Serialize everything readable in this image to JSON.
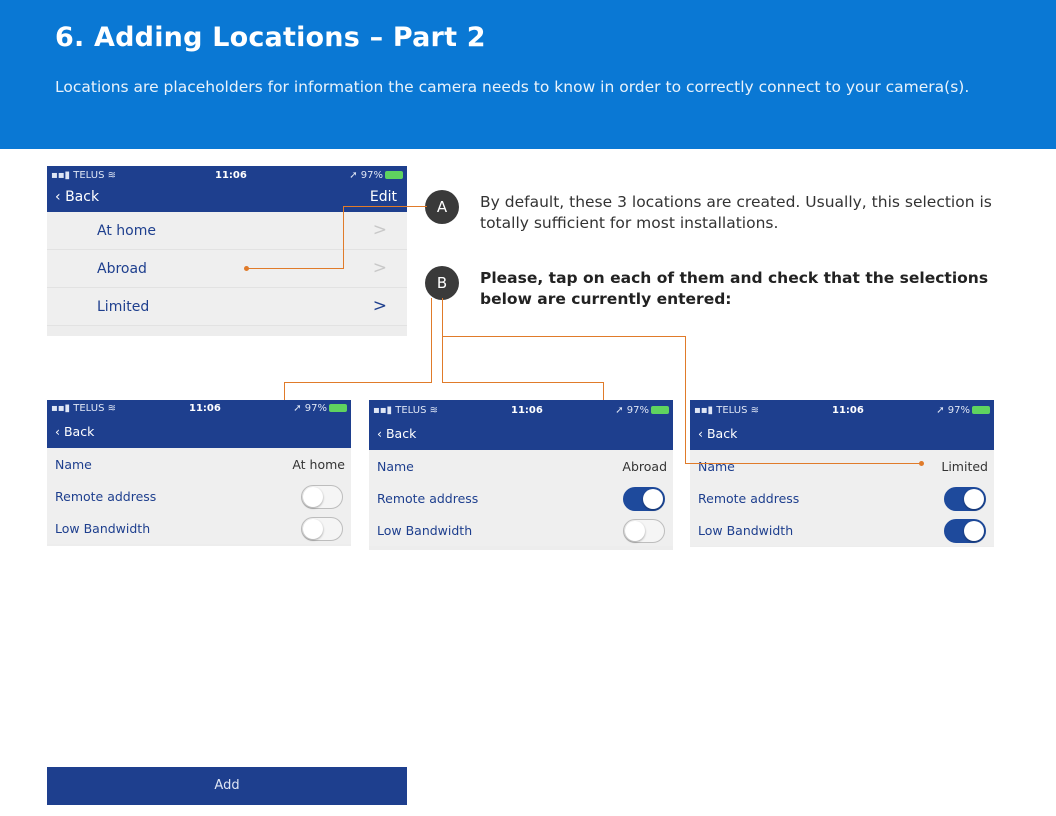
{
  "header": {
    "title": "6. Adding Locations – Part 2",
    "subtitle": "Locations are placeholders for information the camera needs to know in order to correctly connect to your camera(s)."
  },
  "status": {
    "carrier": "TELUS",
    "time": "11:06",
    "battery": "97%"
  },
  "nav": {
    "back": "Back",
    "edit": "Edit"
  },
  "locations": [
    {
      "label": "At home",
      "chevron": ">"
    },
    {
      "label": "Abroad",
      "chevron": ">"
    },
    {
      "label": "Limited",
      "chevron": ">"
    }
  ],
  "notes": {
    "a_badge": "A",
    "a_text": "By default, these 3 locations are created. Usually, this selection is totally sufficient for most installations.",
    "b_badge": "B",
    "b_text": "Please, tap on each of them and check that the selections below are currently entered:"
  },
  "details": {
    "name_label": "Name",
    "remote_label": "Remote address",
    "bandwidth_label": "Low Bandwidth",
    "screens": [
      {
        "name": "At home",
        "remote_on": false,
        "bandwidth_on": false
      },
      {
        "name": "Abroad",
        "remote_on": true,
        "bandwidth_on": false
      },
      {
        "name": "Limited",
        "remote_on": true,
        "bandwidth_on": true
      }
    ]
  },
  "add_button": "Add",
  "colors": {
    "banner": "#0a78d4",
    "nav": "#1e3f8e",
    "connector": "#e07b2a"
  }
}
